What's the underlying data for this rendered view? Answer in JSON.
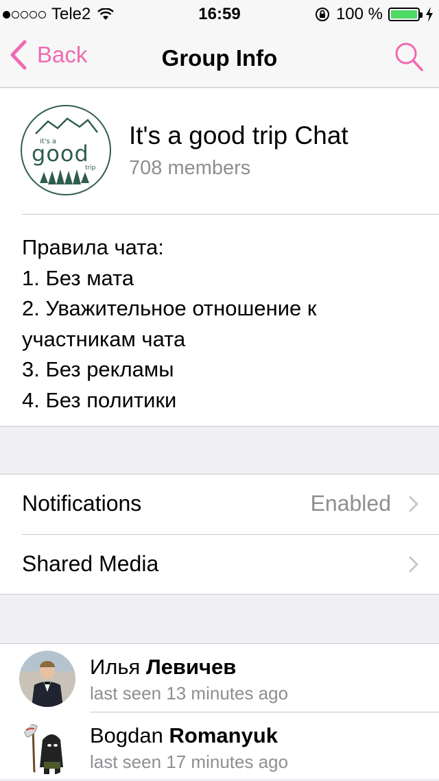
{
  "status_bar": {
    "carrier": "Tele2",
    "time": "16:59",
    "battery_percent": "100 %",
    "signal_bars_filled": 1,
    "signal_bars_total": 5
  },
  "nav": {
    "back_label": "Back",
    "title": "Group Info",
    "accent_color": "#ef6ab0"
  },
  "group": {
    "name": "It's a good trip Chat",
    "members": "708 members",
    "logo_text_small": "it's a",
    "logo_text_main": "good",
    "logo_text_sub": "trip",
    "description_lines": [
      "Правила чата:",
      "1. Без мата",
      "2. Уважительное отношение к",
      "участникам чата",
      "3. Без рекламы",
      "4. Без политики"
    ]
  },
  "settings": {
    "notifications_label": "Notifications",
    "notifications_value": "Enabled",
    "shared_media_label": "Shared Media"
  },
  "members": [
    {
      "first_name": "Илья",
      "last_name": "Левичев",
      "status": "last seen 13 minutes ago"
    },
    {
      "first_name": "Bogdan",
      "last_name": "Romanyuk",
      "status": "last seen 17 minutes ago"
    }
  ]
}
